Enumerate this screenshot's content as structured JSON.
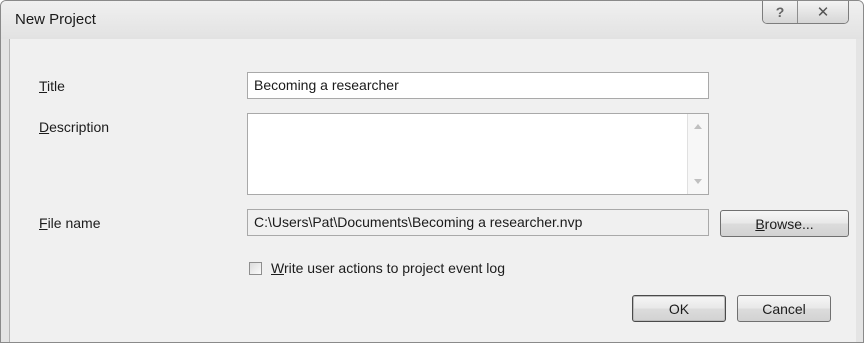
{
  "window": {
    "title": "New Project",
    "help_glyph": "?",
    "close_glyph": "✕"
  },
  "form": {
    "title_label_mnemonic": "T",
    "title_label_rest": "itle",
    "title_value": "Becoming a researcher",
    "description_label_mnemonic": "D",
    "description_label_rest": "escription",
    "description_value": "",
    "file_name_label_mnemonic": "F",
    "file_name_label_rest": "ile name",
    "file_name_value": "C:\\Users\\Pat\\Documents\\Becoming a researcher.nvp",
    "browse_mnemonic": "B",
    "browse_rest": "rowse...",
    "event_log_mnemonic": "W",
    "event_log_rest": "rite user actions to project event log",
    "event_log_checked": false
  },
  "buttons": {
    "ok_label": "OK",
    "cancel_label": "Cancel"
  }
}
